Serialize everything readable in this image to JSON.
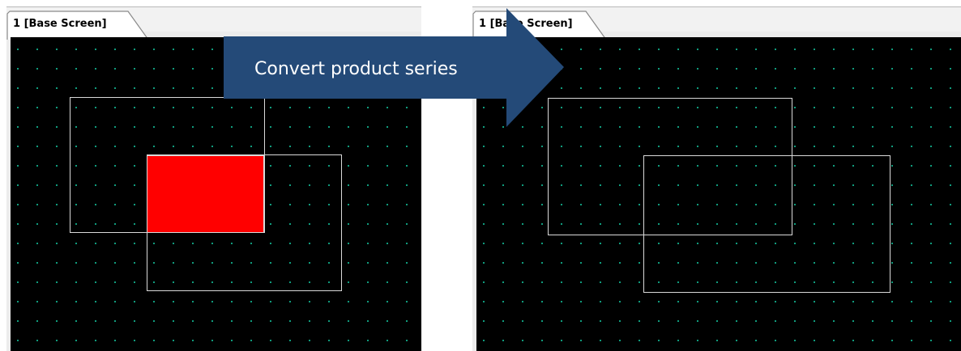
{
  "left_window": {
    "tab_label": "1 [Base Screen]"
  },
  "right_window": {
    "tab_label": "1 [Base Screen]"
  },
  "arrow": {
    "label": "Convert product series",
    "color": "#244a78"
  },
  "colors": {
    "canvas_background": "#000000",
    "grid_dot": "#15c7a0",
    "shape_outline": "#d9d9d9",
    "overlap_fill": "#ff0000"
  }
}
